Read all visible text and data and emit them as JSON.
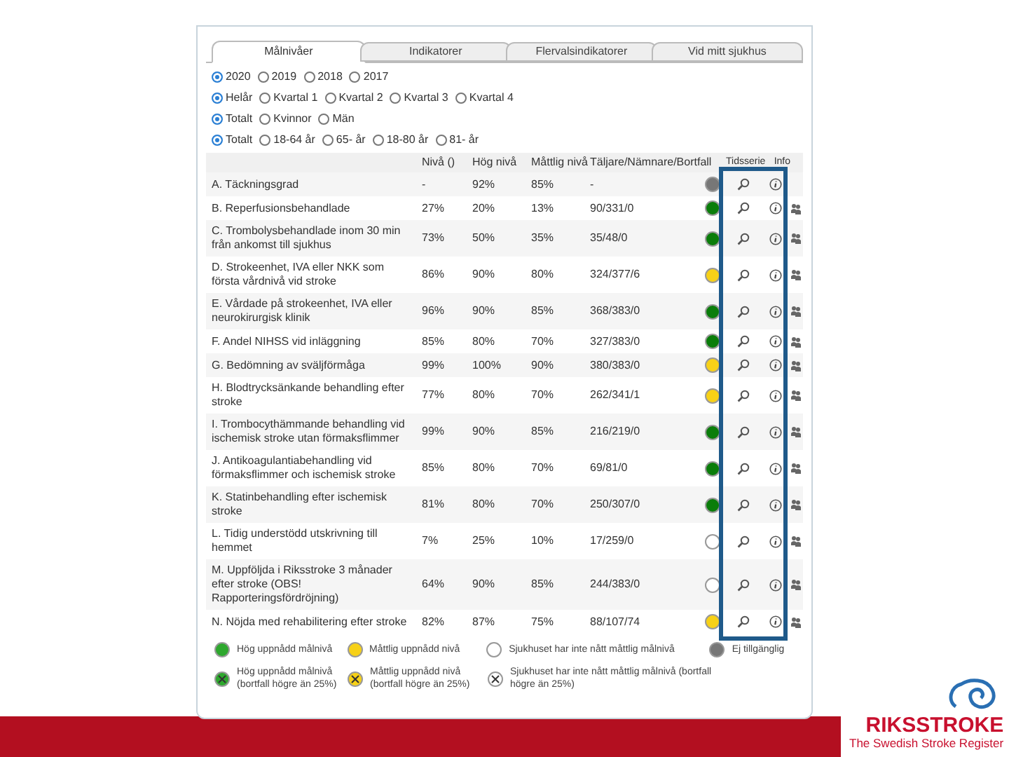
{
  "tabs": [
    {
      "label": "Målnivåer",
      "selected": true
    },
    {
      "label": "Indikatorer",
      "selected": false
    },
    {
      "label": "Flervalsindikatorer",
      "selected": false
    },
    {
      "label": "Vid mitt sjukhus",
      "selected": false
    }
  ],
  "filters": [
    [
      {
        "label": "2020",
        "selected": true
      },
      {
        "label": "2019",
        "selected": false
      },
      {
        "label": "2018",
        "selected": false
      },
      {
        "label": "2017",
        "selected": false
      }
    ],
    [
      {
        "label": "Helår",
        "selected": true
      },
      {
        "label": "Kvartal 1",
        "selected": false
      },
      {
        "label": "Kvartal 2",
        "selected": false
      },
      {
        "label": "Kvartal 3",
        "selected": false
      },
      {
        "label": "Kvartal 4",
        "selected": false
      }
    ],
    [
      {
        "label": "Totalt",
        "selected": true
      },
      {
        "label": "Kvinnor",
        "selected": false
      },
      {
        "label": "Män",
        "selected": false
      }
    ],
    [
      {
        "label": "Totalt",
        "selected": true
      },
      {
        "label": "18-64 år",
        "selected": false
      },
      {
        "label": "65- år",
        "selected": false
      },
      {
        "label": "18-80 år",
        "selected": false
      },
      {
        "label": "81- år",
        "selected": false
      }
    ]
  ],
  "table": {
    "columns": [
      "Nivå ()",
      "Hög nivå",
      "Måttlig nivå",
      "Täljare/Nämnare/Bortfall",
      "Tidsserie",
      "Info"
    ],
    "rows": [
      {
        "name": "A. Täckningsgrad",
        "level_value": "-",
        "high": "92%",
        "moderate": "85%",
        "counts": "-",
        "color": "#777777",
        "group_icon": false
      },
      {
        "name": "B. Reperfusionsbehandlade",
        "level_value": "27%",
        "high": "20%",
        "moderate": "13%",
        "counts": "90/331/0",
        "color": "#0a7d0a",
        "group_icon": true
      },
      {
        "name": "C. Trombolysbehandlade inom 30 min från ankomst till sjukhus",
        "level_value": "73%",
        "high": "50%",
        "moderate": "35%",
        "counts": "35/48/0",
        "color": "#0a7d0a",
        "group_icon": true
      },
      {
        "name": "D. Strokeenhet, IVA eller NKK som första vårdnivå vid stroke",
        "level_value": "86%",
        "high": "90%",
        "moderate": "80%",
        "counts": "324/377/6",
        "color": "#f7d117",
        "group_icon": true
      },
      {
        "name": "E. Vårdade på strokeenhet, IVA eller neurokirurgisk klinik",
        "level_value": "96%",
        "high": "90%",
        "moderate": "85%",
        "counts": "368/383/0",
        "color": "#0a7d0a",
        "group_icon": true
      },
      {
        "name": "F. Andel NIHSS vid inläggning",
        "level_value": "85%",
        "high": "80%",
        "moderate": "70%",
        "counts": "327/383/0",
        "color": "#0a7d0a",
        "group_icon": true
      },
      {
        "name": "G. Bedömning av sväljförmåga",
        "level_value": "99%",
        "high": "100%",
        "moderate": "90%",
        "counts": "380/383/0",
        "color": "#f7d117",
        "group_icon": true
      },
      {
        "name": "H. Blodtrycksänkande behandling efter stroke",
        "level_value": "77%",
        "high": "80%",
        "moderate": "70%",
        "counts": "262/341/1",
        "color": "#f7d117",
        "group_icon": true
      },
      {
        "name": "I. Trombocythämmande behandling vid ischemisk stroke utan förmaksflimmer",
        "level_value": "99%",
        "high": "90%",
        "moderate": "85%",
        "counts": "216/219/0",
        "color": "#0a7d0a",
        "group_icon": true
      },
      {
        "name": "J. Antikoagulantiabehandling vid förmaksflimmer och ischemisk stroke",
        "level_value": "85%",
        "high": "80%",
        "moderate": "70%",
        "counts": "69/81/0",
        "color": "#0a7d0a",
        "group_icon": true
      },
      {
        "name": "K. Statinbehandling efter ischemisk stroke",
        "level_value": "81%",
        "high": "80%",
        "moderate": "70%",
        "counts": "250/307/0",
        "color": "#0a7d0a",
        "group_icon": true
      },
      {
        "name": "L. Tidig understödd utskrivning till hemmet",
        "level_value": "7%",
        "high": "25%",
        "moderate": "10%",
        "counts": "17/259/0",
        "color": "#ffffff",
        "group_icon": true
      },
      {
        "name": "M. Uppföljda i Riksstroke 3 månader efter stroke (OBS! Rapporteringsfördröjning)",
        "level_value": "64%",
        "high": "90%",
        "moderate": "85%",
        "counts": "244/383/0",
        "color": "#ffffff",
        "group_icon": true
      },
      {
        "name": "N. Nöjda med rehabilitering efter stroke",
        "level_value": "82%",
        "high": "87%",
        "moderate": "75%",
        "counts": "88/107/74",
        "color": "#f7d117",
        "group_icon": true
      }
    ]
  },
  "legend": [
    [
      {
        "label": "Hög uppnådd målnivå",
        "color": "#2ea82e",
        "crossed": false
      },
      {
        "label": "Måttlig uppnådd nivå",
        "color": "#f7d117",
        "crossed": false
      },
      {
        "label": "Sjukhuset har inte nått måttlig målnivå",
        "color": "#ffffff",
        "crossed": false
      },
      {
        "label": "Ej tillgänglig",
        "color": "#777777",
        "crossed": false
      }
    ],
    [
      {
        "label": "Hög uppnådd målnivå (bortfall högre än 25%)",
        "color": "#2ea82e",
        "crossed": true
      },
      {
        "label": "Måttlig uppnådd nivå (bortfall högre än 25%)",
        "color": "#f7d117",
        "crossed": true
      },
      {
        "label": "Sjukhuset har inte nått måttlig målnivå (bortfall högre än 25%)",
        "color": "#ffffff",
        "crossed": true
      }
    ]
  ],
  "logo": {
    "name": "RIKSSTROKE",
    "tagline": "The Swedish Stroke Register"
  }
}
